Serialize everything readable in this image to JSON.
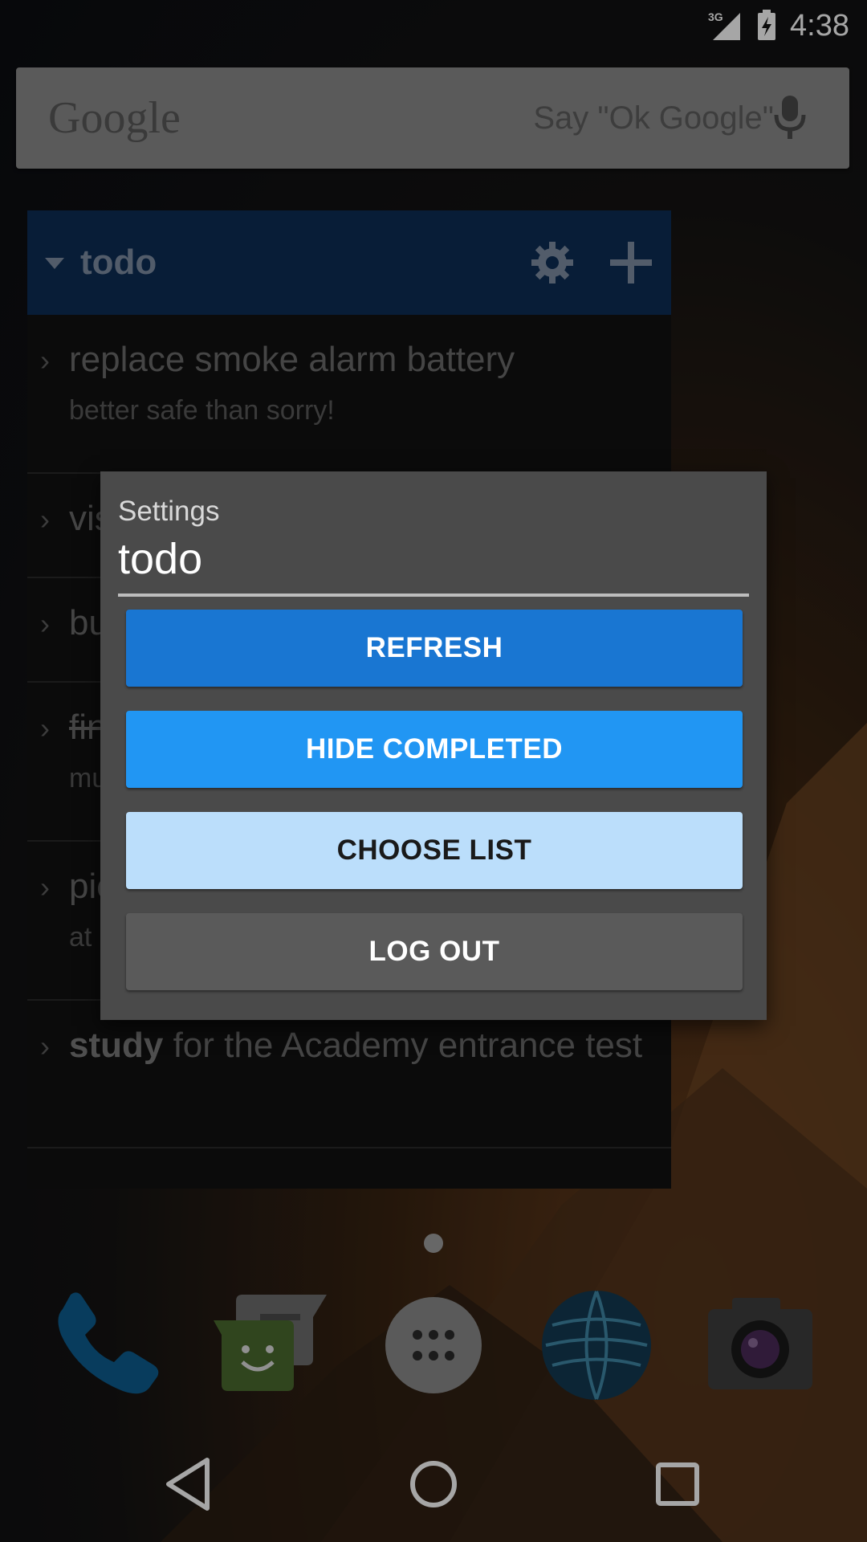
{
  "status_bar": {
    "network": "3G",
    "time": "4:38"
  },
  "search": {
    "logo": "Google",
    "hint": "Say \"Ok Google\"",
    "mic_icon": "microphone-icon"
  },
  "widget": {
    "list_name": "todo",
    "items": [
      {
        "title": "replace smoke alarm battery",
        "subtitle": "better safe than sorry!"
      },
      {
        "title": "vis",
        "subtitle": ""
      },
      {
        "title": "bu",
        "subtitle": ""
      },
      {
        "title": "fin",
        "subtitle": "mu",
        "completed": true
      },
      {
        "title": "pic",
        "subtitle": "at"
      },
      {
        "title_bold": "study",
        "title": " for the Academy entrance test",
        "subtitle": ""
      }
    ]
  },
  "dialog": {
    "label": "Settings",
    "name": "todo",
    "buttons": {
      "refresh": "REFRESH",
      "hide_completed": "HIDE COMPLETED",
      "choose_list": "CHOOSE LIST",
      "log_out": "LOG OUT"
    }
  },
  "dock": [
    "phone-app-icon",
    "messenger-app-icon",
    "app-drawer-icon",
    "browser-globe-icon",
    "camera-app-icon"
  ],
  "colors": {
    "widget_header": "#0d2d55",
    "refresh": "#1976d2",
    "hide_completed": "#2196f3",
    "choose_list": "#bbdefb",
    "log_out": "#5a5a5a"
  }
}
